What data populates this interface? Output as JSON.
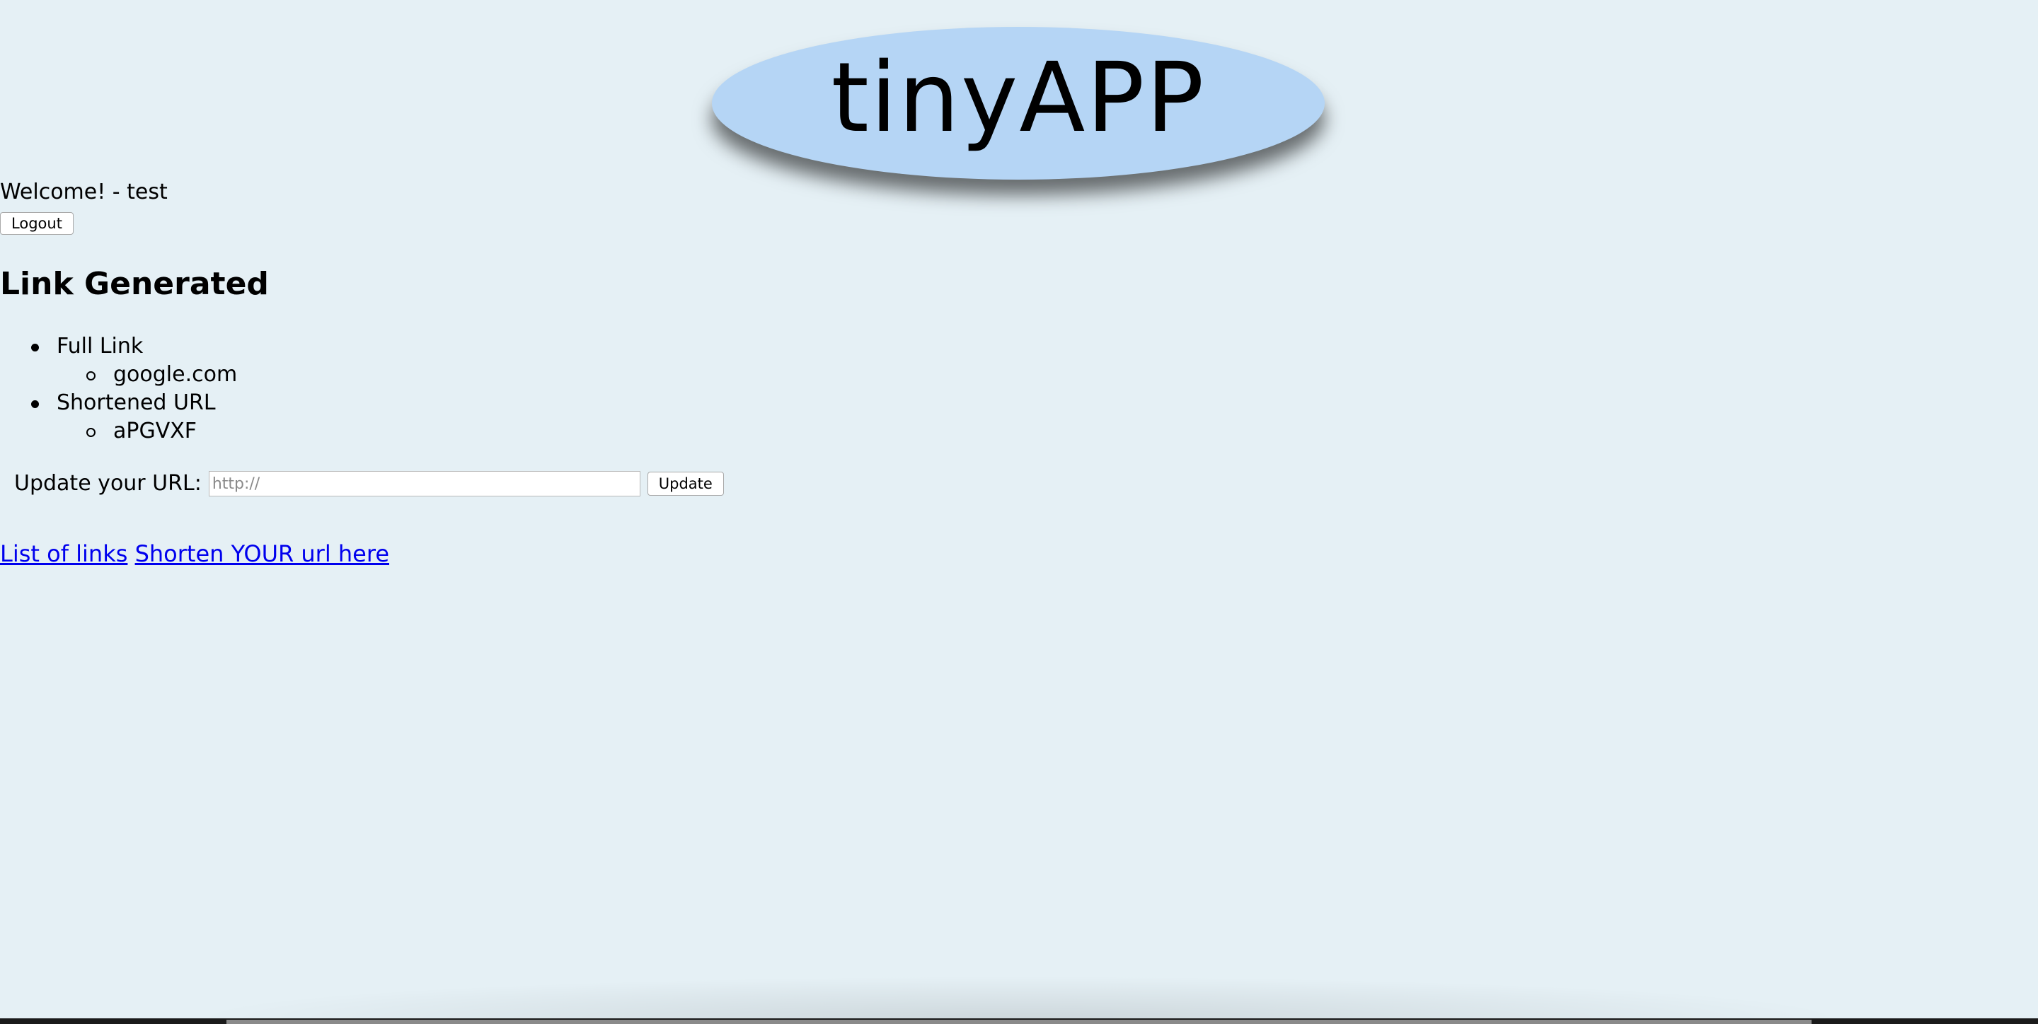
{
  "header": {
    "logo_text": "tinyAPP"
  },
  "user": {
    "welcome_text": "Welcome! - test",
    "logout_label": "Logout"
  },
  "main": {
    "heading": "Link Generated",
    "items": [
      {
        "label": "Full Link",
        "value": "google.com"
      },
      {
        "label": "Shortened URL",
        "value": "aPGVXF"
      }
    ]
  },
  "update_form": {
    "label": "Update your URL:",
    "input_value": "",
    "input_placeholder": "http://",
    "button_label": "Update"
  },
  "footer_links": {
    "list_of_links": "List of links",
    "shorten_url": "Shorten YOUR url here"
  },
  "colors": {
    "background": "#e5f0f5",
    "logo_oval": "#b5d5f5",
    "link": "#0000ee"
  }
}
